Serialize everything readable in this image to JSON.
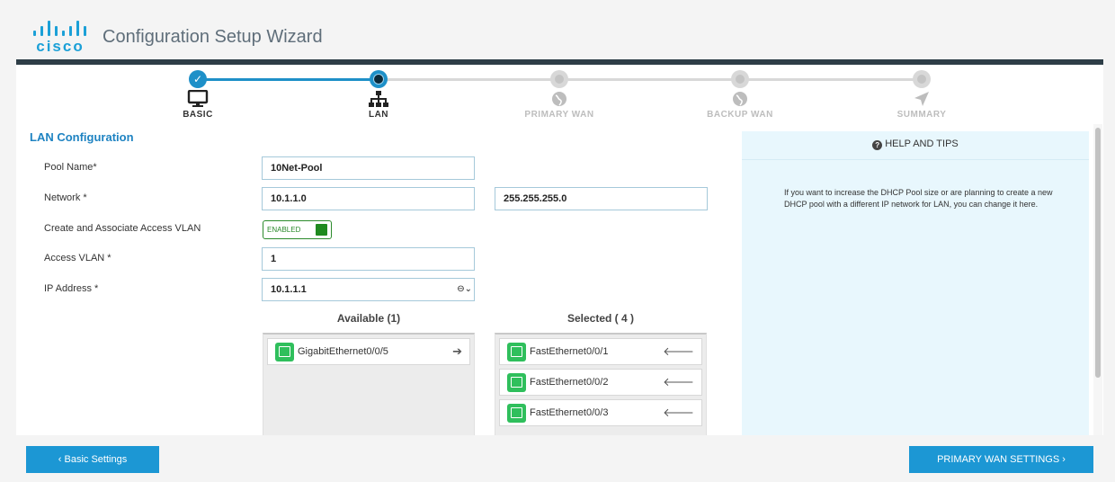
{
  "app": {
    "brand": "cisco",
    "title": "Configuration Setup Wizard"
  },
  "wizard": {
    "steps": [
      {
        "label": "BASIC",
        "state": "done",
        "icon": "monitor-icon"
      },
      {
        "label": "LAN",
        "state": "current",
        "icon": "network-tree-icon"
      },
      {
        "label": "PRIMARY WAN",
        "state": "todo",
        "icon": "globe-icon"
      },
      {
        "label": "BACKUP WAN",
        "state": "todo",
        "icon": "globe-icon"
      },
      {
        "label": "SUMMARY",
        "state": "todo",
        "icon": "send-arrow-icon"
      }
    ],
    "done_mark": "✓"
  },
  "section": {
    "title": "LAN Configuration"
  },
  "form": {
    "pool_name": {
      "label": "Pool Name*",
      "value": "10Net-Pool"
    },
    "network": {
      "label": "Network *",
      "value": "10.1.1.0",
      "mask": "255.255.255.0"
    },
    "access_vlan_toggle": {
      "label": "Create and Associate Access VLAN",
      "state": "ENABLED"
    },
    "access_vlan": {
      "label": "Access VLAN *",
      "value": "1"
    },
    "ip_address": {
      "label": "IP Address *",
      "value": "10.1.1.1",
      "caret": "⊖⌄"
    }
  },
  "available": {
    "title": "Available (1)",
    "items": [
      {
        "name": "GigabitEthernet0/0/5",
        "arrow": "➔"
      }
    ]
  },
  "selected": {
    "title": "Selected ( 4 )",
    "items": [
      {
        "name": "FastEthernet0/0/1",
        "arrow": "🡐"
      },
      {
        "name": "FastEthernet0/0/2",
        "arrow": "🡐"
      },
      {
        "name": "FastEthernet0/0/3",
        "arrow": "🡐"
      }
    ]
  },
  "help": {
    "title": "HELP AND TIPS",
    "icon": "?",
    "text": "If you want to increase the DHCP Pool size or are planning to create a new DHCP pool with a different IP network for LAN, you can change it here."
  },
  "footer": {
    "back_label": "‹ Basic Settings",
    "next_label": "PRIMARY WAN SETTINGS ›"
  },
  "colors": {
    "accent": "#1c97d4",
    "enabled": "#1f8a1f",
    "port_icon": "#2fbf5c",
    "help_bg": "#e8f7fd"
  }
}
